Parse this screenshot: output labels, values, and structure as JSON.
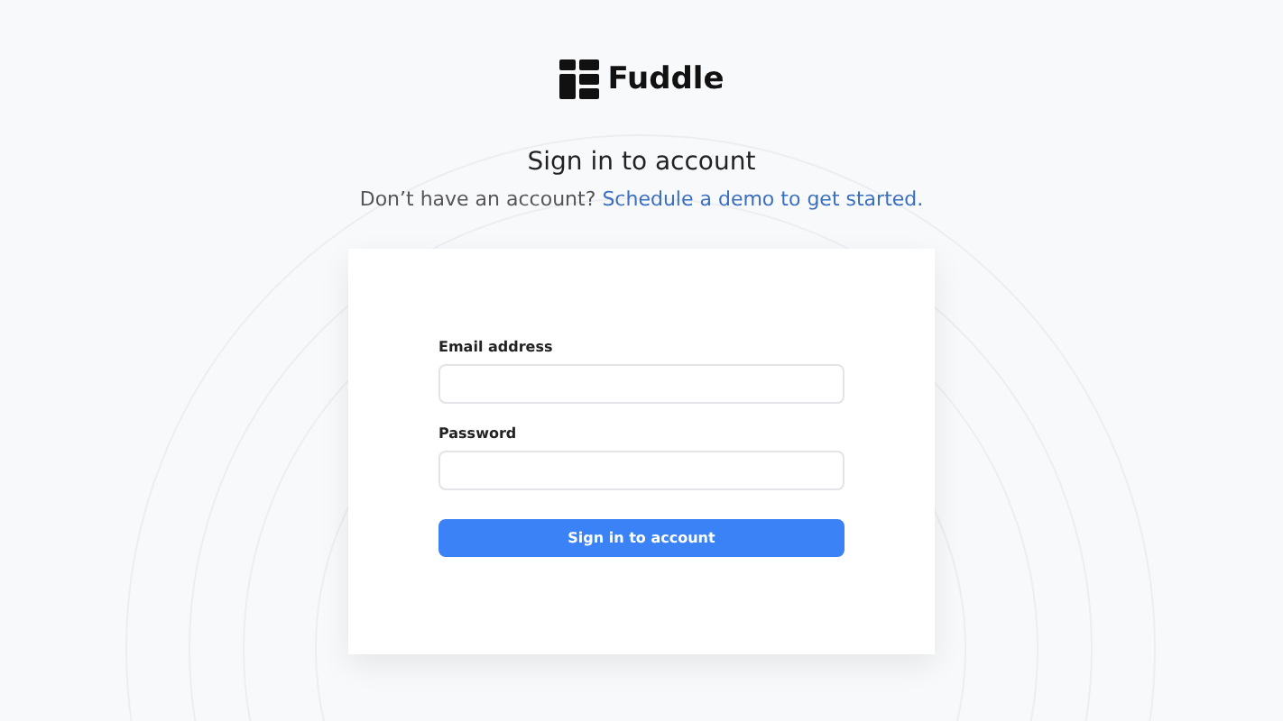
{
  "logo": {
    "name": "Fuddle"
  },
  "heading": "Sign in to account",
  "subtitle": {
    "text": "Don’t have an account?",
    "link": "Schedule a demo to get started."
  },
  "form": {
    "fields": [
      {
        "label": "Email address"
      },
      {
        "label": "Password"
      }
    ],
    "submit": "Sign in to account"
  }
}
